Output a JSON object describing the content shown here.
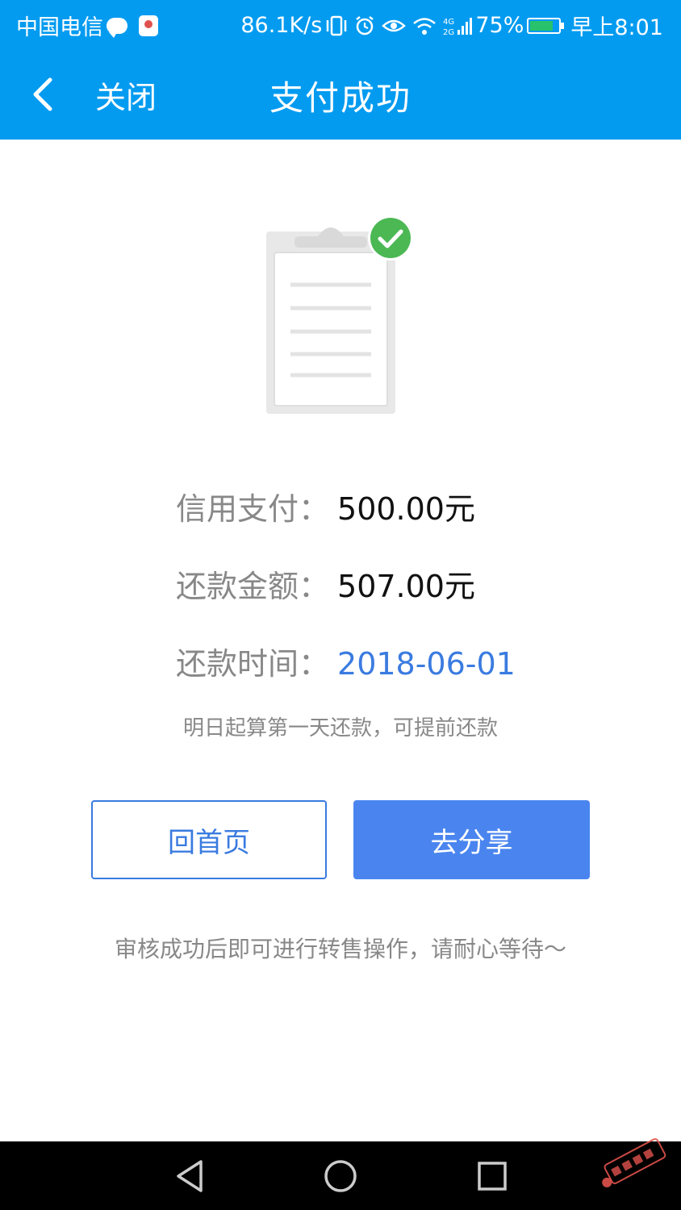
{
  "status_bar": {
    "carrier": "中国电信",
    "speed": "86.1K/s",
    "battery_percent": "75%",
    "time": "早上8:01"
  },
  "header": {
    "back_label": "关闭",
    "title": "支付成功"
  },
  "info": {
    "credit_label": "信用支付：",
    "credit_value": "500.00元",
    "repay_amount_label": "还款金额：",
    "repay_amount_value": "507.00元",
    "repay_time_label": "还款时间：",
    "repay_time_value": "2018-06-01",
    "note": "明日起算第一天还款，可提前还款"
  },
  "buttons": {
    "home": "回首页",
    "share": "去分享"
  },
  "tip": "审核成功后即可进行转售操作，请耐心等待～",
  "colors": {
    "primary_blue": "#039bf0",
    "accent_blue": "#3a7be0",
    "button_blue": "#4a85ef",
    "success_green": "#4cb854",
    "muted_text": "#888888"
  },
  "icons": {
    "back": "chevron-left-icon",
    "success": "check-circle-icon",
    "document": "clipboard-icon",
    "nav_back": "triangle-back-icon",
    "nav_home": "circle-home-icon",
    "nav_recent": "square-recent-icon"
  }
}
